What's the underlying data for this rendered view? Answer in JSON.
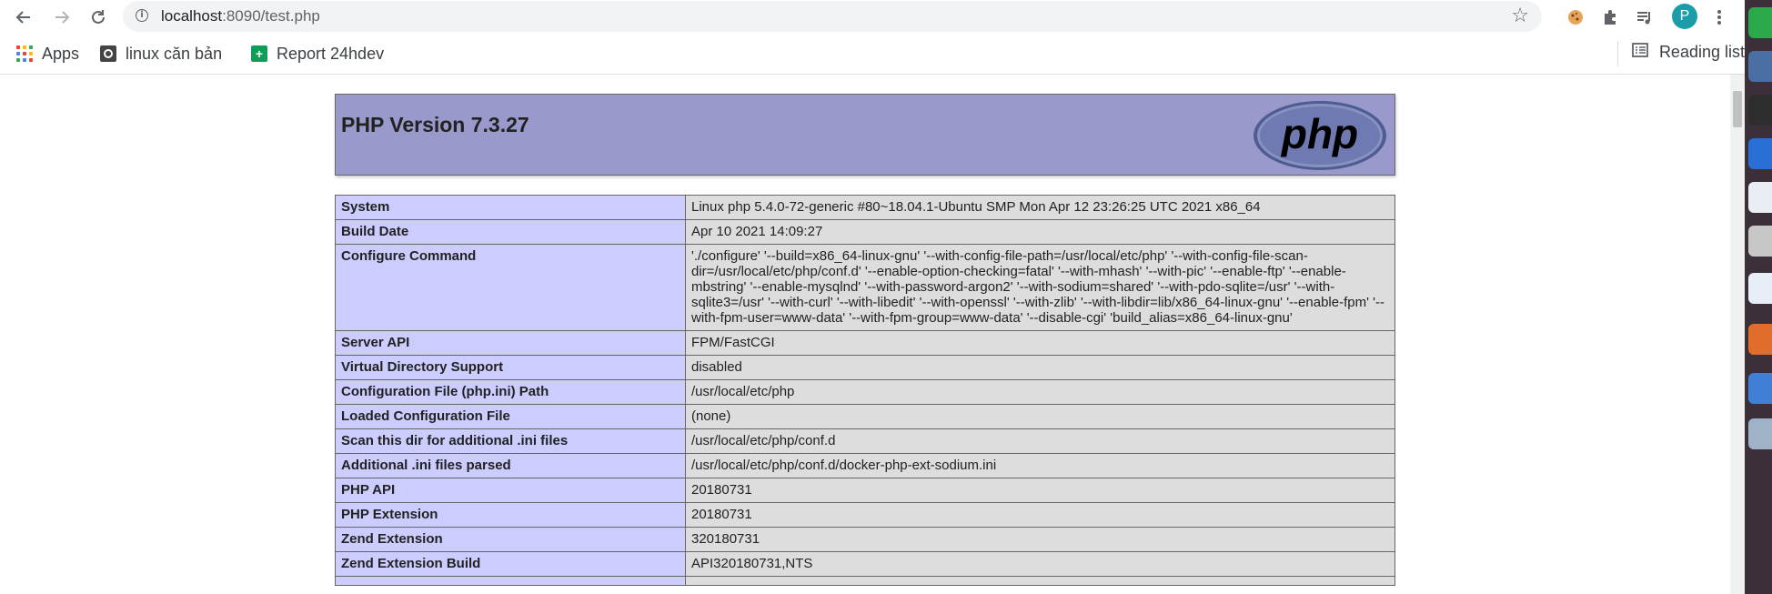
{
  "browser": {
    "url_host": "localhost",
    "url_path": ":8090/test.php",
    "bookmarks": [
      {
        "label": "Apps"
      },
      {
        "label": "linux căn bản"
      },
      {
        "label": "Report 24hdev"
      }
    ],
    "reading_list": "Reading list",
    "profile_initial": "P",
    "colors": {
      "toolbar": "#ffffff",
      "omnibox": "#f1f3f4",
      "avatar": "#1a9da8",
      "report_icon": "#0f9d58"
    }
  },
  "php": {
    "version_title": "PHP Version 7.3.27",
    "logo_text": "php",
    "colors": {
      "header": "#9999cc",
      "key_cell": "#ccccff",
      "value_cell": "#dddddd"
    }
  },
  "info_rows": [
    {
      "key": "System",
      "value": "Linux php 5.4.0-72-generic #80~18.04.1-Ubuntu SMP Mon Apr 12 23:26:25 UTC 2021 x86_64"
    },
    {
      "key": "Build Date",
      "value": "Apr 10 2021 14:09:27"
    },
    {
      "key": "Configure Command",
      "value": "'./configure' '--build=x86_64-linux-gnu' '--with-config-file-path=/usr/local/etc/php' '--with-config-file-scan-dir=/usr/local/etc/php/conf.d' '--enable-option-checking=fatal' '--with-mhash' '--with-pic' '--enable-ftp' '--enable-mbstring' '--enable-mysqlnd' '--with-password-argon2' '--with-sodium=shared' '--with-pdo-sqlite=/usr' '--with-sqlite3=/usr' '--with-curl' '--with-libedit' '--with-openssl' '--with-zlib' '--with-libdir=lib/x86_64-linux-gnu' '--enable-fpm' '--with-fpm-user=www-data' '--with-fpm-group=www-data' '--disable-cgi' 'build_alias=x86_64-linux-gnu'"
    },
    {
      "key": "Server API",
      "value": "FPM/FastCGI"
    },
    {
      "key": "Virtual Directory Support",
      "value": "disabled"
    },
    {
      "key": "Configuration File (php.ini) Path",
      "value": "/usr/local/etc/php"
    },
    {
      "key": "Loaded Configuration File",
      "value": "(none)"
    },
    {
      "key": "Scan this dir for additional .ini files",
      "value": "/usr/local/etc/php/conf.d"
    },
    {
      "key": "Additional .ini files parsed",
      "value": "/usr/local/etc/php/conf.d/docker-php-ext-sodium.ini"
    },
    {
      "key": "PHP API",
      "value": "20180731"
    },
    {
      "key": "PHP Extension",
      "value": "20180731"
    },
    {
      "key": "Zend Extension",
      "value": "320180731"
    },
    {
      "key": "Zend Extension Build",
      "value": "API320180731,NTS"
    },
    {
      "key": "",
      "value": ""
    }
  ]
}
